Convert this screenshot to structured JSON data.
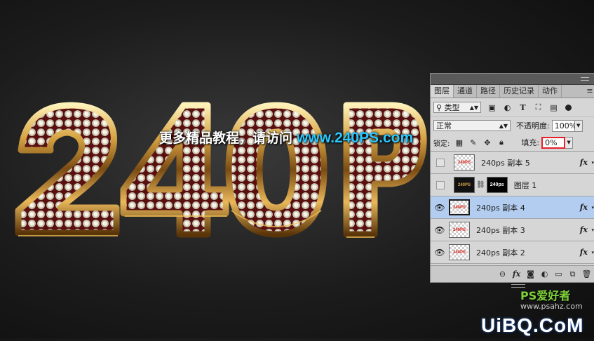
{
  "artwork": {
    "headline": "240P",
    "banner_text": "更多精品教程，请访问",
    "banner_url": "www.240PS.com"
  },
  "panel": {
    "tabs": [
      "图层",
      "通道",
      "路径",
      "历史记录",
      "动作"
    ],
    "filter_kind": "类型",
    "blend_mode": "正常",
    "opacity_label": "不透明度:",
    "opacity_value": "100%",
    "lock_label": "锁定:",
    "fill_label": "填充:",
    "fill_value": "0%",
    "layers": [
      {
        "name": "240ps 副本 5",
        "visible": false,
        "fx": "fx",
        "thumb": "240PS"
      },
      {
        "name": "图层 1",
        "visible": false,
        "fx": "",
        "thumb": "240PS",
        "mask": "240ps"
      },
      {
        "name": "240ps 副本 4",
        "visible": true,
        "fx": "fx",
        "thumb": "240PS",
        "selected": true
      },
      {
        "name": "240ps 副本 3",
        "visible": true,
        "fx": "fx",
        "thumb": "240PS"
      },
      {
        "name": "240ps 副本 2",
        "visible": true,
        "fx": "fx",
        "thumb": "240PS"
      }
    ],
    "footer_fx": "fx"
  },
  "watermark": {
    "top": "PS爱好者",
    "middle": "www.psahz.com",
    "bottom": "UiBQ.CoM"
  },
  "colors": {
    "accent_blue": "#28c8ff",
    "selection": "#b3cdf0",
    "fill_highlight": "#e8202a",
    "gold": "#d4a24a"
  }
}
